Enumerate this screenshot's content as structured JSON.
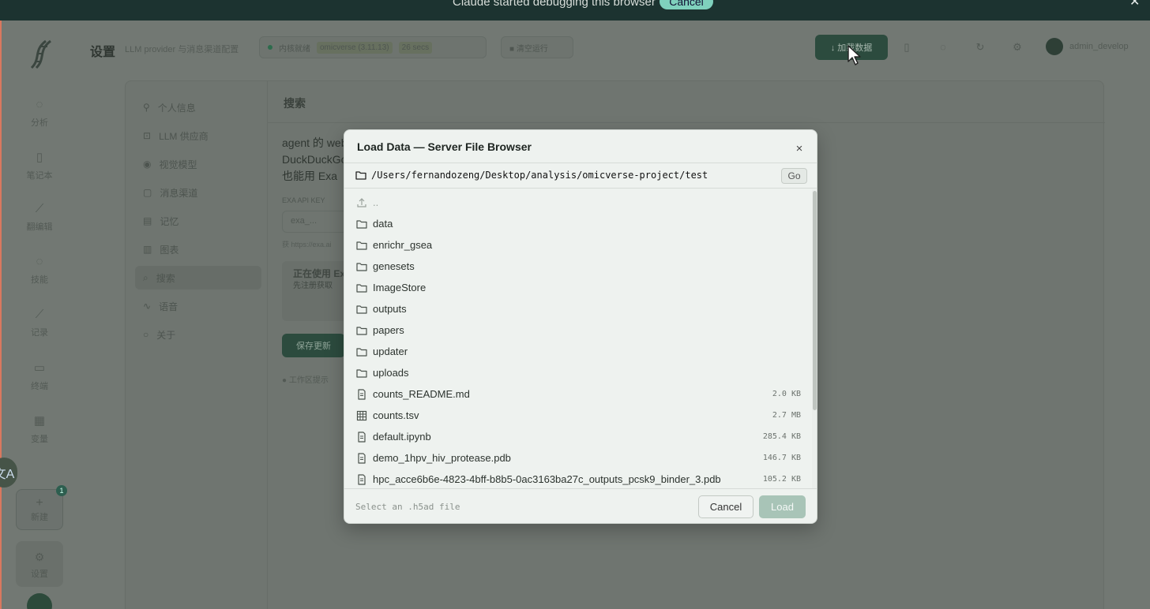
{
  "debug_banner": {
    "text": "Claude started debugging this browser",
    "cancel_label": "Cancel",
    "close_glyph": "✕"
  },
  "app": {
    "rail": {
      "items": [
        {
          "label": "分析",
          "icon": "chat-icon"
        },
        {
          "label": "笔记本",
          "icon": "notebook-icon"
        },
        {
          "label": "翻编辑",
          "icon": "tool-icon"
        },
        {
          "label": "技能",
          "icon": "skill-icon"
        },
        {
          "label": "记录",
          "icon": "log-icon"
        },
        {
          "label": "终端",
          "icon": "terminal-icon"
        },
        {
          "label": "变量",
          "icon": "variable-icon"
        }
      ],
      "new_label": "新建",
      "new_badge": "1",
      "settings_label": "设置",
      "translate_glyph": "文A"
    },
    "topbar": {
      "title": "设置",
      "subtitle": "LLM provider 与消息渠道配置",
      "pill_status": "内核就绪",
      "pill_env": "omicverse (3.11.13)",
      "pill_mem": "26 secs",
      "pill_run": "■ 清空运行",
      "dark_button": "↓ 加载数据",
      "user": "admin_develop"
    },
    "settings_nav": [
      {
        "label": "个人信息",
        "icon": "user-icon"
      },
      {
        "label": "LLM 供应商",
        "icon": "lock-icon"
      },
      {
        "label": "视觉模型",
        "icon": "eye-icon"
      },
      {
        "label": "消息渠道",
        "icon": "message-icon"
      },
      {
        "label": "记忆",
        "icon": "memory-icon"
      },
      {
        "label": "图表",
        "icon": "chart-icon"
      },
      {
        "label": "搜索",
        "icon": "search-icon",
        "active": true
      },
      {
        "label": "语音",
        "icon": "voice-icon"
      },
      {
        "label": "关于",
        "icon": "info-icon"
      }
    ],
    "settings_main": {
      "title": "搜索",
      "text": "agent 的 web DuckDuckGo 填也能用 Exa",
      "label": "EXA API KEY",
      "input_value": "exa_...",
      "hint": "获 https://exa.ai",
      "info_title": "正在使用 Ex",
      "info_sub": "先注册获取",
      "save": "保存更新",
      "footer": "● 工作区提示"
    }
  },
  "modal": {
    "title": "Load Data — Server File Browser",
    "close_glyph": "×",
    "path": "/Users/fernandozeng/Desktop/analysis/omicverse-project/test",
    "go_label": "Go",
    "up_label": "..",
    "entries": [
      {
        "name": "data",
        "type": "folder",
        "size": ""
      },
      {
        "name": "enrichr_gsea",
        "type": "folder",
        "size": ""
      },
      {
        "name": "genesets",
        "type": "folder",
        "size": ""
      },
      {
        "name": "ImageStore",
        "type": "folder",
        "size": ""
      },
      {
        "name": "outputs",
        "type": "folder",
        "size": ""
      },
      {
        "name": "papers",
        "type": "folder",
        "size": ""
      },
      {
        "name": "updater",
        "type": "folder",
        "size": ""
      },
      {
        "name": "uploads",
        "type": "folder",
        "size": ""
      },
      {
        "name": "counts_README.md",
        "type": "file",
        "size": "2.0 KB"
      },
      {
        "name": "counts.tsv",
        "type": "table",
        "size": "2.7 MB"
      },
      {
        "name": "default.ipynb",
        "type": "file",
        "size": "285.4 KB"
      },
      {
        "name": "demo_1hpv_hiv_protease.pdb",
        "type": "file",
        "size": "146.7 KB"
      },
      {
        "name": "hpc_acce6b6e-4823-4bff-b8b5-0ac3163ba27c_outputs_pcsk9_binder_3.pdb",
        "type": "file",
        "size": "105.2 KB"
      }
    ],
    "footer_hint": "Select an .h5ad file",
    "cancel_label": "Cancel",
    "load_label": "Load"
  },
  "colors": {
    "accent_green": "#2c4b3e",
    "load_disabled": "#a8c4b7",
    "banner": "#1c3330",
    "banner_button": "#7fd1bd"
  }
}
